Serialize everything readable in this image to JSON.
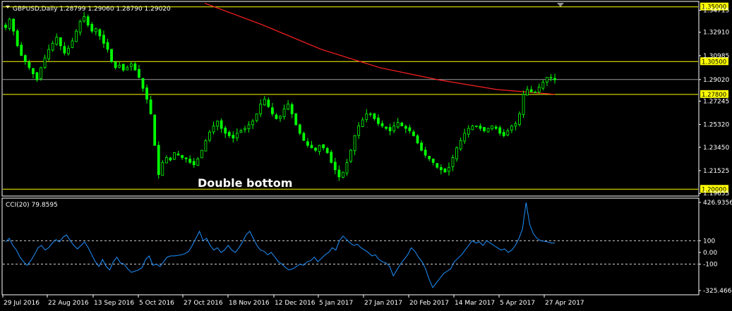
{
  "window": {
    "header": "GBPUSD,Daily  1.28799 1.29060 1.28790 1.29020",
    "indicator_header": "CCI(20) 79.8595"
  },
  "colors": {
    "background": "#000000",
    "frame": "#ffffff",
    "candle": "#00ff00",
    "moving_average": "#ff2020",
    "level_line": "#ffff00",
    "cci_line": "#1e90ff",
    "level_label_bg": "#ffff00"
  },
  "chart_data": [
    {
      "type": "candlestick",
      "symbol": "GBPUSD",
      "timeframe": "Daily",
      "title": "GBPUSD,Daily  1.28799 1.29060 1.28790 1.29020",
      "ylim": [
        1.19655,
        1.355
      ],
      "y_ticks": [
        "1.34715",
        "1.32910",
        "1.30985",
        "1.29020",
        "1.27245",
        "1.25320",
        "1.23450",
        "1.21525",
        "1.19655"
      ],
      "x_ticks": [
        "29 Jul 2016",
        "22 Aug 2016",
        "13 Sep 2016",
        "5 Oct 2016",
        "27 Oct 2016",
        "18 Nov 2016",
        "12 Dec 2016",
        "5 Jan 2017",
        "27 Jan 2017",
        "20 Feb 2017",
        "14 Mar 2017",
        "5 Apr 2017",
        "27 Apr 2017"
      ],
      "horizontal_levels": [
        {
          "value": 1.35,
          "label": "1.35000"
        },
        {
          "value": 1.305,
          "label": "1.30500"
        },
        {
          "value": 1.278,
          "label": "1.27800"
        },
        {
          "value": 1.2,
          "label": "1.20000"
        }
      ],
      "current_price": {
        "value": 1.2902,
        "label": "1.29020"
      },
      "annotation": "Double bottom",
      "close_series_approx": [
        1.333,
        1.34,
        1.33,
        1.318,
        1.31,
        1.305,
        1.3,
        1.295,
        1.29,
        1.3,
        1.308,
        1.315,
        1.32,
        1.325,
        1.318,
        1.312,
        1.316,
        1.322,
        1.33,
        1.338,
        1.342,
        1.335,
        1.33,
        1.332,
        1.326,
        1.32,
        1.315,
        1.305,
        1.3,
        1.302,
        1.298,
        1.3,
        1.303,
        1.298,
        1.292,
        1.283,
        1.274,
        1.262,
        1.236,
        1.212,
        1.222,
        1.226,
        1.224,
        1.23,
        1.228,
        1.226,
        1.225,
        1.222,
        1.22,
        1.225,
        1.232,
        1.24,
        1.247,
        1.252,
        1.256,
        1.25,
        1.246,
        1.244,
        1.242,
        1.246,
        1.248,
        1.25,
        1.253,
        1.256,
        1.262,
        1.27,
        1.274,
        1.268,
        1.262,
        1.258,
        1.26,
        1.266,
        1.27,
        1.262,
        1.253,
        1.246,
        1.24,
        1.236,
        1.234,
        1.232,
        1.236,
        1.234,
        1.23,
        1.222,
        1.216,
        1.21,
        1.214,
        1.222,
        1.232,
        1.244,
        1.252,
        1.257,
        1.262,
        1.262,
        1.258,
        1.254,
        1.252,
        1.25,
        1.248,
        1.252,
        1.255,
        1.252,
        1.25,
        1.248,
        1.244,
        1.238,
        1.232,
        1.228,
        1.225,
        1.222,
        1.218,
        1.216,
        1.214,
        1.218,
        1.226,
        1.234,
        1.24,
        1.246,
        1.25,
        1.252,
        1.252,
        1.25,
        1.248,
        1.25,
        1.252,
        1.25,
        1.246,
        1.244,
        1.248,
        1.252,
        1.254,
        1.262,
        1.278,
        1.282,
        1.28,
        1.28,
        1.284,
        1.288,
        1.292,
        1.292,
        1.29
      ],
      "moving_average_approx": [
        1.353,
        1.335,
        1.315,
        1.3,
        1.29,
        1.282,
        1.278
      ]
    },
    {
      "type": "line",
      "indicator": "CCI(20)",
      "current_value": 79.8595,
      "ylim": [
        -325.4667,
        426.9356
      ],
      "y_ticks": [
        "426.9356",
        "100",
        "0.00",
        "-100",
        "-325.4667"
      ],
      "levels": [
        100,
        -100
      ],
      "values_approx": [
        90,
        120,
        60,
        20,
        -40,
        -80,
        -110,
        -70,
        -20,
        40,
        60,
        20,
        40,
        80,
        110,
        90,
        130,
        150,
        100,
        60,
        30,
        60,
        90,
        40,
        -20,
        -80,
        -120,
        -60,
        -120,
        -150,
        -80,
        -40,
        -90,
        -100,
        -140,
        -170,
        -160,
        -150,
        -130,
        -60,
        -30,
        -110,
        -100,
        -120,
        -80,
        -40,
        -30,
        -30,
        -25,
        -20,
        -10,
        10,
        60,
        120,
        180,
        100,
        120,
        60,
        20,
        40,
        0,
        20,
        60,
        20,
        0,
        40,
        90,
        150,
        180,
        120,
        60,
        20,
        10,
        -20,
        0,
        -40,
        -80,
        -100,
        -130,
        -150,
        -140,
        -120,
        -100,
        -110,
        -80,
        -70,
        -40,
        -80,
        -50,
        -20,
        0,
        40,
        20,
        100,
        140,
        110,
        80,
        60,
        70,
        40,
        20,
        0,
        -30,
        -20,
        -60,
        -80,
        -90,
        -120,
        -200,
        -150,
        -100,
        -60,
        -20,
        40,
        10,
        -40,
        -80,
        -140,
        -230,
        -300,
        -260,
        -220,
        -180,
        -160,
        -140,
        -80,
        -50,
        -20,
        20,
        60,
        100,
        80,
        90,
        60,
        100,
        80,
        60,
        40,
        20,
        30,
        0,
        20,
        60,
        120,
        200,
        426,
        240,
        160,
        120,
        100,
        95,
        90,
        80,
        80
      ]
    }
  ]
}
